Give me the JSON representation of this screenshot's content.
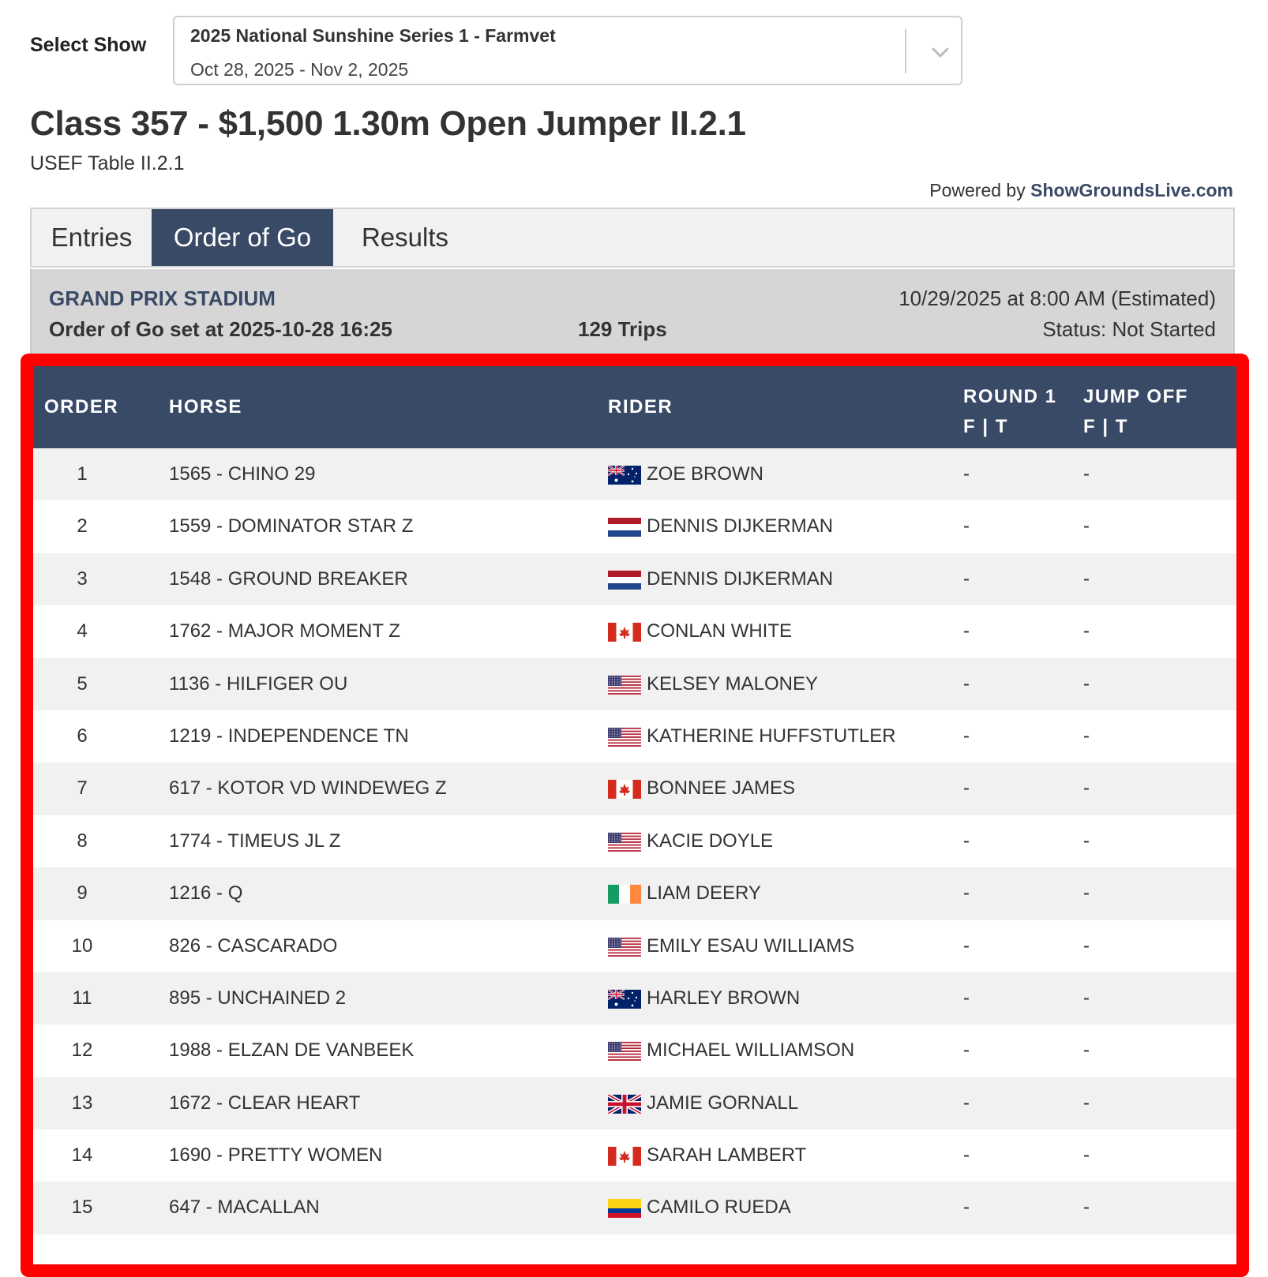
{
  "header": {
    "select_label": "Select Show",
    "show_name": "2025 National Sunshine Series 1 - Farmvet",
    "show_dates": "Oct 28, 2025 - Nov 2, 2025",
    "dropdown_icon": "chevron-down-icon"
  },
  "class_info": {
    "title": "Class 357 - $1,500 1.30m Open Jumper II.2.1",
    "subtitle": "USEF Table II.2.1"
  },
  "powered": {
    "prefix": "Powered by",
    "brand": "ShowGroundsLive.com"
  },
  "tabs": [
    {
      "label": "Entries",
      "active": false
    },
    {
      "label": "Order of Go",
      "active": true
    },
    {
      "label": "Results",
      "active": false
    }
  ],
  "ring": {
    "name": "GRAND PRIX STADIUM",
    "order_set": "Order of Go set at 2025-10-28 16:25",
    "trips": "129 Trips",
    "schedule": "10/29/2025 at 8:00 AM (Estimated)",
    "status": "Status: Not Started"
  },
  "table": {
    "headers": {
      "order": "ORDER",
      "horse": "HORSE",
      "rider": "RIDER",
      "round1_line1": "ROUND 1",
      "round1_line2": "F | T",
      "jumpoff_line1": "JUMP OFF",
      "jumpoff_line2": "F | T"
    },
    "rows": [
      {
        "order": "1",
        "horse": "1565 - CHINO 29",
        "flag": "AUS",
        "rider": "ZOE BROWN",
        "round1": "-",
        "jumpoff": "-"
      },
      {
        "order": "2",
        "horse": "1559 - DOMINATOR STAR Z",
        "flag": "NED",
        "rider": "DENNIS DIJKERMAN",
        "round1": "-",
        "jumpoff": "-"
      },
      {
        "order": "3",
        "horse": "1548 - GROUND BREAKER",
        "flag": "NED",
        "rider": "DENNIS DIJKERMAN",
        "round1": "-",
        "jumpoff": "-"
      },
      {
        "order": "4",
        "horse": "1762 - MAJOR MOMENT Z",
        "flag": "CAN",
        "rider": "CONLAN WHITE",
        "round1": "-",
        "jumpoff": "-"
      },
      {
        "order": "5",
        "horse": "1136 - HILFIGER OU",
        "flag": "USA",
        "rider": "KELSEY MALONEY",
        "round1": "-",
        "jumpoff": "-"
      },
      {
        "order": "6",
        "horse": "1219 - INDEPENDENCE TN",
        "flag": "USA",
        "rider": "KATHERINE HUFFSTUTLER",
        "round1": "-",
        "jumpoff": "-"
      },
      {
        "order": "7",
        "horse": "617 - KOTOR VD WINDEWEG Z",
        "flag": "CAN",
        "rider": "BONNEE JAMES",
        "round1": "-",
        "jumpoff": "-"
      },
      {
        "order": "8",
        "horse": "1774 - TIMEUS JL Z",
        "flag": "USA",
        "rider": "KACIE DOYLE",
        "round1": "-",
        "jumpoff": "-"
      },
      {
        "order": "9",
        "horse": "1216 - Q",
        "flag": "IRL",
        "rider": "LIAM DEERY",
        "round1": "-",
        "jumpoff": "-"
      },
      {
        "order": "10",
        "horse": "826 - CASCARADO",
        "flag": "USA",
        "rider": "EMILY ESAU WILLIAMS",
        "round1": "-",
        "jumpoff": "-"
      },
      {
        "order": "11",
        "horse": "895 - UNCHAINED 2",
        "flag": "AUS",
        "rider": "HARLEY BROWN",
        "round1": "-",
        "jumpoff": "-"
      },
      {
        "order": "12",
        "horse": "1988 - ELZAN DE VANBEEK",
        "flag": "USA",
        "rider": "MICHAEL WILLIAMSON",
        "round1": "-",
        "jumpoff": "-"
      },
      {
        "order": "13",
        "horse": "1672 - CLEAR HEART",
        "flag": "GBR",
        "rider": "JAMIE GORNALL",
        "round1": "-",
        "jumpoff": "-"
      },
      {
        "order": "14",
        "horse": "1690 - PRETTY WOMEN",
        "flag": "CAN",
        "rider": "SARAH LAMBERT",
        "round1": "-",
        "jumpoff": "-"
      },
      {
        "order": "15",
        "horse": "647 - MACALLAN",
        "flag": "COL",
        "rider": "CAMILO RUEDA",
        "round1": "-",
        "jumpoff": "-"
      }
    ]
  },
  "colors": {
    "header_bg": "#394a66",
    "highlight_border": "#ff0000",
    "row_alt": "#f1f1f1",
    "info_bg": "#d6d6d6"
  }
}
